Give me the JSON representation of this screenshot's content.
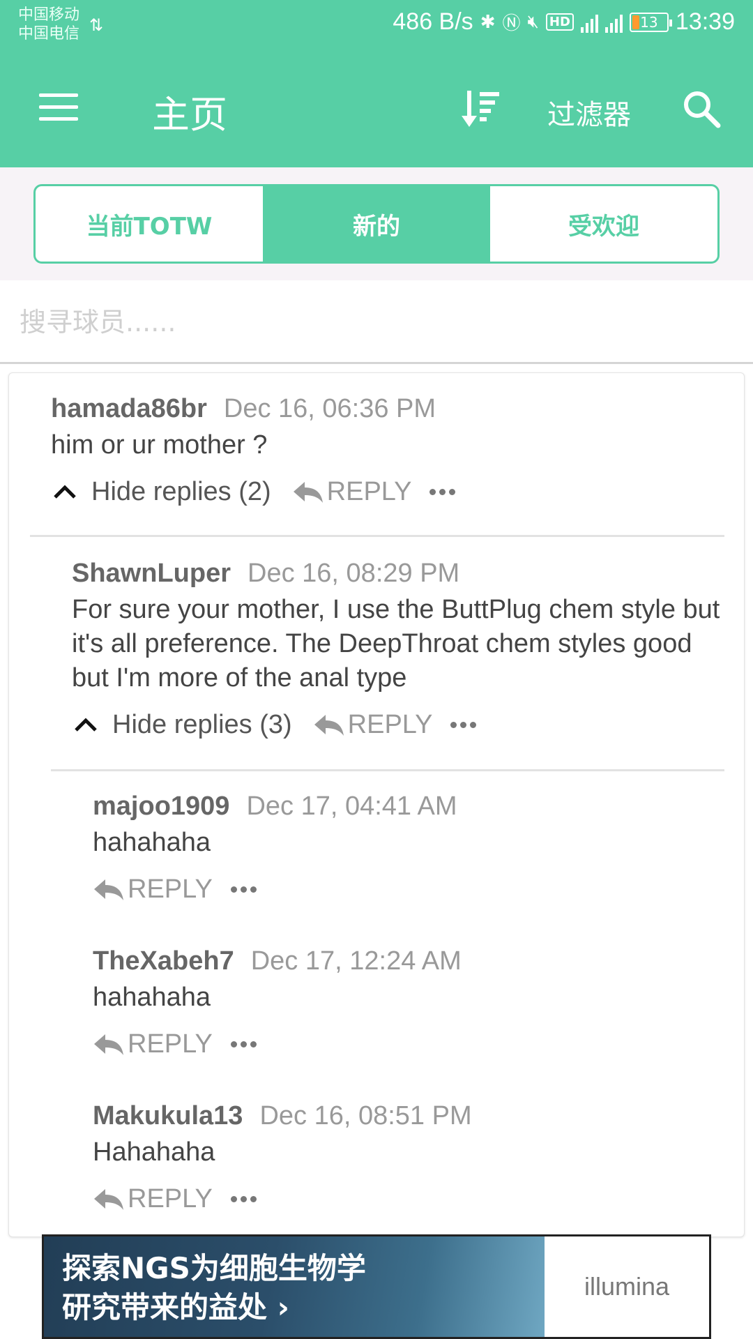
{
  "status_bar": {
    "carrier_1": "中国移动",
    "carrier_2": "中国电信",
    "net_speed": "486 B/s",
    "battery": "13",
    "time": "13:39",
    "accent": "#57cfa5"
  },
  "app_bar": {
    "title": "主页",
    "filter_label": "过滤器",
    "icons": [
      "menu-icon",
      "sort-icon",
      "search-icon"
    ]
  },
  "tabs": [
    {
      "label": "当前TOTW",
      "active": false
    },
    {
      "label": "新的",
      "active": true
    },
    {
      "label": "受欢迎",
      "active": false
    }
  ],
  "search": {
    "placeholder": "搜寻球员......",
    "value": ""
  },
  "comments": [
    {
      "user": "hamada86br",
      "time": "Dec 16, 06:36 PM",
      "text": "him or ur mother ?",
      "hide_replies": "Hide replies (2)",
      "reply": "REPLY"
    },
    {
      "user": "ShawnLuper",
      "time": "Dec 16, 08:29 PM",
      "text": "For sure your mother, I use the ButtPlug chem style but it's all preference. The DeepThroat chem styles good but I'm more of the anal type",
      "hide_replies": "Hide replies (3)",
      "reply": "REPLY"
    },
    {
      "user": "majoo1909",
      "time": "Dec 17, 04:41 AM",
      "text": "hahahaha",
      "reply": "REPLY"
    },
    {
      "user": "TheXabeh7",
      "time": "Dec 17, 12:24 AM",
      "text": "hahahaha",
      "reply": "REPLY"
    },
    {
      "user": "Makukula13",
      "time": "Dec 16, 08:51 PM",
      "text": "Hahahaha",
      "reply": "REPLY"
    }
  ],
  "ad": {
    "line_1": "探索NGS为细胞生物学",
    "line_2": "研究带来的益处",
    "brand": "illumina"
  }
}
